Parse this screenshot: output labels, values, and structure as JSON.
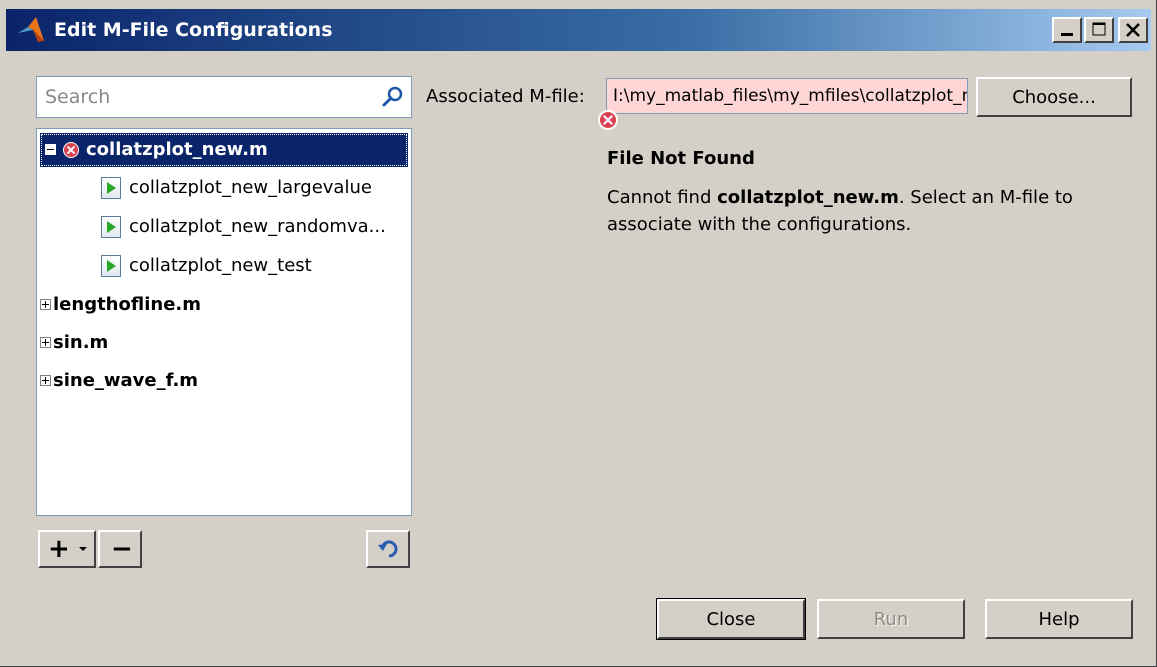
{
  "window": {
    "title": "Edit M-File Configurations",
    "accent_color": "#0a246a",
    "controls": [
      "minimize-icon",
      "maximize-icon",
      "close-icon"
    ]
  },
  "search": {
    "placeholder": "Search",
    "icon": "search-icon"
  },
  "tree": {
    "root": {
      "label": "collatzplot_new.m",
      "expanded": true,
      "selected": true,
      "status": "error",
      "children": [
        {
          "label": "collatzplot_new_largevalue",
          "icon": "run-config-icon"
        },
        {
          "label": "collatzplot_new_randomva...",
          "icon": "run-config-icon"
        },
        {
          "label": "collatzplot_new_test",
          "icon": "run-config-icon"
        }
      ]
    },
    "others": [
      {
        "label": "lengthofline.m",
        "expanded": false
      },
      {
        "label": "sin.m",
        "expanded": false
      },
      {
        "label": "sine_wave_f.m",
        "expanded": false
      }
    ]
  },
  "toolbar": {
    "add": "+",
    "remove": "−",
    "add_icon": "plus-dropdown-icon",
    "remove_icon": "minus-icon",
    "refresh_icon": "undo-icon"
  },
  "assoc": {
    "label": "Associated M-file:",
    "value": "I:\\my_matlab_files\\my_mfiles\\collatzplot_new.m",
    "error_color": "#ffd6d6",
    "choose": "Choose..."
  },
  "message": {
    "title": "File Not Found",
    "prefix": "Cannot find ",
    "filename": "collatzplot_new.m",
    "suffix": ". Select an M-file to associate with the configurations."
  },
  "buttons": {
    "close": "Close",
    "run": "Run",
    "help": "Help",
    "run_enabled": false
  }
}
